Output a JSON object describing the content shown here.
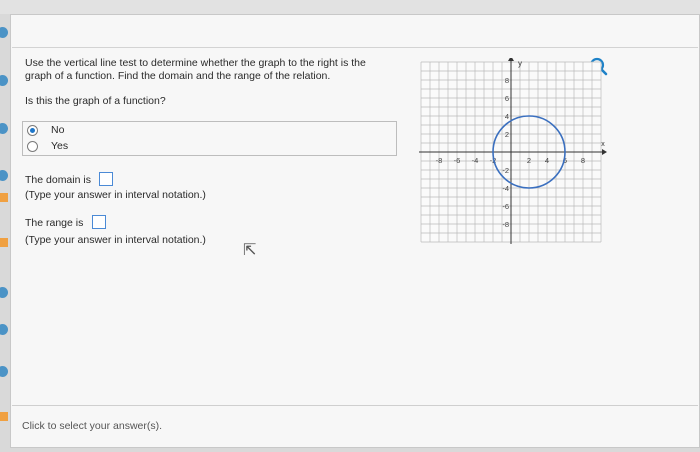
{
  "header": {
    "title_fragment": "",
    "right_fragment": ""
  },
  "question": {
    "line1": "Use the vertical line test to determine whether the graph to the right is the",
    "line2": "graph of a function. Find the domain and the range of the relation.",
    "prompt": "Is this the graph of a function?"
  },
  "choices": [
    {
      "label": "No",
      "selected": true
    },
    {
      "label": "Yes",
      "selected": false
    }
  ],
  "domain": {
    "label": "The domain is",
    "hint": "(Type your answer in interval notation.)"
  },
  "range": {
    "label": "The range is",
    "hint": "(Type your answer in interval notation.)"
  },
  "footer": {
    "text": "Click to select your answer(s)."
  },
  "graph": {
    "y_axis_label": "y",
    "x_axis_label": "x",
    "x_ticks": [
      "-8",
      "-6",
      "-4",
      "-2",
      "2",
      "4",
      "6",
      "8"
    ],
    "y_ticks": [
      "8",
      "6",
      "4",
      "2",
      "-2",
      "-4",
      "-6",
      "-8"
    ],
    "x_min": -10,
    "x_max": 10,
    "y_min": -10,
    "y_max": 10,
    "circle": {
      "center_x": 2,
      "center_y": 0,
      "radius": 4
    },
    "circle_color": "#3a6fbf",
    "grid": true
  },
  "icons": {
    "zoom": "zoom-in-icon"
  },
  "colors": {
    "accent": "#4b93c6",
    "marker_orange": "#f0a041"
  }
}
